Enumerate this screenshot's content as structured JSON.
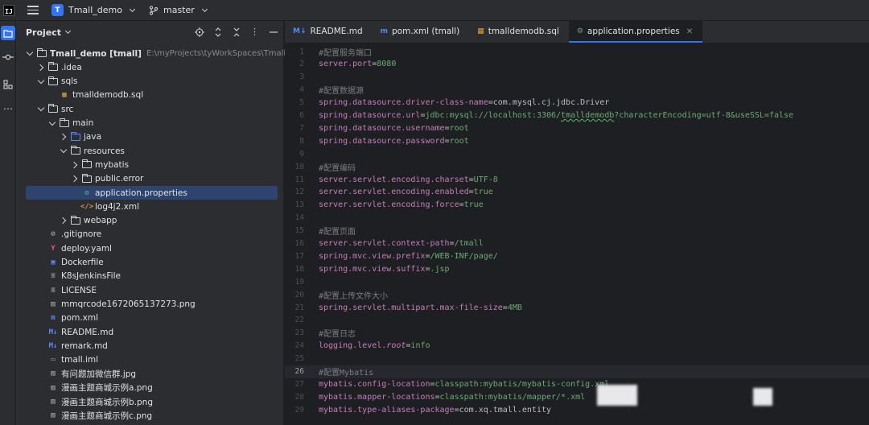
{
  "titlebar": {
    "project_badge": "T",
    "project_name": "Tmall_demo",
    "branch": "master"
  },
  "panel": {
    "title": "Project"
  },
  "tree": [
    {
      "label": "Tmall_demo [tmall]",
      "sub": "E:\\myProjects\\tyWorkSpaces\\Tmall_demo",
      "depth": 0,
      "arrow": "open",
      "icon": "folder",
      "bold": true
    },
    {
      "label": ".idea",
      "depth": 1,
      "arrow": "closed",
      "icon": "folder"
    },
    {
      "label": "sqls",
      "depth": 1,
      "arrow": "open",
      "icon": "folder"
    },
    {
      "label": "tmalldemodb.sql",
      "depth": 2,
      "arrow": "none",
      "icon": "sql"
    },
    {
      "label": "src",
      "depth": 1,
      "arrow": "open",
      "icon": "folder"
    },
    {
      "label": "main",
      "depth": 2,
      "arrow": "open",
      "icon": "folder"
    },
    {
      "label": "java",
      "depth": 3,
      "arrow": "closed",
      "icon": "folder-blue"
    },
    {
      "label": "resources",
      "depth": 3,
      "arrow": "open",
      "icon": "folder-res"
    },
    {
      "label": "mybatis",
      "depth": 4,
      "arrow": "closed",
      "icon": "folder"
    },
    {
      "label": "public.error",
      "depth": 4,
      "arrow": "closed",
      "icon": "folder"
    },
    {
      "label": "application.properties",
      "depth": 4,
      "arrow": "none",
      "icon": "props",
      "selected": true
    },
    {
      "label": "log4j2.xml",
      "depth": 4,
      "arrow": "none",
      "icon": "xml"
    },
    {
      "label": "webapp",
      "depth": 3,
      "arrow": "closed",
      "icon": "folder-web"
    },
    {
      "label": ".gitignore",
      "depth": 1,
      "arrow": "none",
      "icon": "gitignore"
    },
    {
      "label": "deploy.yaml",
      "depth": 1,
      "arrow": "none",
      "icon": "yaml"
    },
    {
      "label": "Dockerfile",
      "depth": 1,
      "arrow": "none",
      "icon": "docker"
    },
    {
      "label": "K8sJenkinsFile",
      "depth": 1,
      "arrow": "none",
      "icon": "text"
    },
    {
      "label": "LICENSE",
      "depth": 1,
      "arrow": "none",
      "icon": "text"
    },
    {
      "label": "mmqrcode1672065137273.png",
      "depth": 1,
      "arrow": "none",
      "icon": "image"
    },
    {
      "label": "pom.xml",
      "depth": 1,
      "arrow": "none",
      "icon": "maven"
    },
    {
      "label": "README.md",
      "depth": 1,
      "arrow": "none",
      "icon": "md"
    },
    {
      "label": "remark.md",
      "depth": 1,
      "arrow": "none",
      "icon": "md"
    },
    {
      "label": "tmall.iml",
      "depth": 1,
      "arrow": "none",
      "icon": "iml"
    },
    {
      "label": "有问题加微信群.jpg",
      "depth": 1,
      "arrow": "none",
      "icon": "image"
    },
    {
      "label": "漫画主题商城示例a.png",
      "depth": 1,
      "arrow": "none",
      "icon": "image"
    },
    {
      "label": "漫画主题商城示例b.png",
      "depth": 1,
      "arrow": "none",
      "icon": "image"
    },
    {
      "label": "漫画主题商城示例c.png",
      "depth": 1,
      "arrow": "none",
      "icon": "image"
    }
  ],
  "tabs": [
    {
      "label": "README.md",
      "icon": "M↓",
      "icon_color": "#548af7",
      "active": false
    },
    {
      "label": "pom.xml (tmall)",
      "icon": "m",
      "icon_color": "#548af7",
      "active": false
    },
    {
      "label": "tmalldemodb.sql",
      "icon": "sql-icon",
      "icon_color": "#d9a343",
      "active": false
    },
    {
      "label": "application.properties",
      "icon": "props-icon",
      "icon_color": "#6aab73",
      "active": true,
      "closable": true
    }
  ],
  "code_lines": [
    {
      "n": "1",
      "type": "comment",
      "text": "#配置服务端口"
    },
    {
      "n": "2",
      "type": "kv",
      "key": "server.port",
      "value": "8080"
    },
    {
      "n": "3",
      "type": "blank"
    },
    {
      "n": "4",
      "type": "comment",
      "text": "#配置数据源"
    },
    {
      "n": "5",
      "type": "kv",
      "key": "spring.datasource.driver-class-name",
      "value": "com.mysql.cj.jdbc.Driver",
      "vstyle": "plain"
    },
    {
      "n": "6",
      "type": "url",
      "key": "spring.datasource.url",
      "pre": "jdbc:mysql://localhost:3306/",
      "typo": "tmalldemodb",
      "post": "?characterEncoding=utf-8&useSSL=false"
    },
    {
      "n": "7",
      "type": "kv",
      "key": "spring.datasource.username",
      "value": "root"
    },
    {
      "n": "8",
      "type": "kv",
      "key": "spring.datasource.password",
      "value": "root"
    },
    {
      "n": "9",
      "type": "blank"
    },
    {
      "n": "10",
      "type": "comment",
      "text": "#配置编码"
    },
    {
      "n": "11",
      "type": "kv",
      "key": "server.servlet.encoding.charset",
      "value": "UTF-8"
    },
    {
      "n": "12",
      "type": "kv",
      "key": "server.servlet.encoding.enabled",
      "value": "true"
    },
    {
      "n": "13",
      "type": "kv",
      "key": "server.servlet.encoding.force",
      "value": "true"
    },
    {
      "n": "14",
      "type": "blank"
    },
    {
      "n": "15",
      "type": "comment",
      "text": "#配置页面"
    },
    {
      "n": "16",
      "type": "kv",
      "key": "server.servlet.context-path",
      "value": "/tmall"
    },
    {
      "n": "17",
      "type": "kv",
      "key": "spring.mvc.view.prefix",
      "value": "/WEB-INF/page/"
    },
    {
      "n": "18",
      "type": "kv",
      "key": "spring.mvc.view.suffix",
      "value": ".jsp"
    },
    {
      "n": "19",
      "type": "blank"
    },
    {
      "n": "20",
      "type": "comment",
      "text": "#配置上传文件大小"
    },
    {
      "n": "21",
      "type": "kv",
      "key": "spring.servlet.multipart.max-file-size",
      "value": "4MB"
    },
    {
      "n": "22",
      "type": "blank"
    },
    {
      "n": "23",
      "type": "comment",
      "text": "#配置日志"
    },
    {
      "n": "24",
      "type": "log",
      "key_pre": "logging.level.",
      "key_it": "root",
      "value": "info"
    },
    {
      "n": "25",
      "type": "blank"
    },
    {
      "n": "26",
      "type": "comment",
      "text": "#配置Mybatis",
      "current": true
    },
    {
      "n": "27",
      "type": "kv",
      "key": "mybatis.config-location",
      "value": "classpath:mybatis/mybatis-config.xml"
    },
    {
      "n": "28",
      "type": "kv",
      "key": "mybatis.mapper-locations",
      "value": "classpath:mybatis/mapper/*.xml"
    },
    {
      "n": "29",
      "type": "kv",
      "key": "mybatis.type-aliases-package",
      "value": "com.xq.tmall.entity",
      "vstyle": "plain"
    }
  ]
}
